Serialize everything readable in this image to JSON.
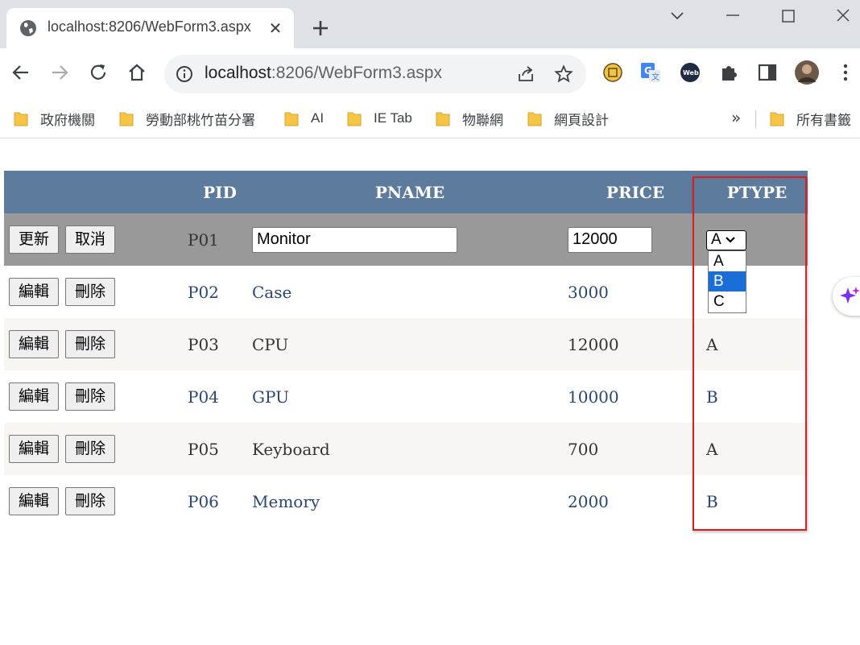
{
  "browser": {
    "tab_title": "localhost:8206/WebForm3.aspx",
    "tab_close": "✕",
    "url_host": "localhost",
    "url_rest": ":8206/WebForm3.aspx"
  },
  "bookmarks": {
    "items": [
      "政府機關",
      "勞動部桃竹苗分署",
      "AI",
      "IE Tab",
      "物聯網",
      "網頁設計"
    ],
    "more": "»",
    "all": "所有書籤"
  },
  "grid": {
    "headers": [
      "",
      "PID",
      "PNAME",
      "PRICE",
      "PTYPE"
    ],
    "edit_row": {
      "update_label": "更新",
      "cancel_label": "取消",
      "pid": "P01",
      "pname": "Monitor",
      "price": "12000",
      "ptype": "A"
    },
    "rows": [
      {
        "edit": "編輯",
        "delete": "刪除",
        "pid": "P02",
        "pname": "Case",
        "price": "3000",
        "ptype": ""
      },
      {
        "edit": "編輯",
        "delete": "刪除",
        "pid": "P03",
        "pname": "CPU",
        "price": "12000",
        "ptype": "A"
      },
      {
        "edit": "編輯",
        "delete": "刪除",
        "pid": "P04",
        "pname": "GPU",
        "price": "10000",
        "ptype": "B"
      },
      {
        "edit": "編輯",
        "delete": "刪除",
        "pid": "P05",
        "pname": "Keyboard",
        "price": "700",
        "ptype": "A"
      },
      {
        "edit": "編輯",
        "delete": "刪除",
        "pid": "P06",
        "pname": "Memory",
        "price": "2000",
        "ptype": "B"
      }
    ],
    "ptype_options": [
      "A",
      "B",
      "C"
    ],
    "ptype_highlighted_option": "B"
  },
  "colors": {
    "header_bg": "#5d7b9d",
    "edit_row_bg": "#999999",
    "alt_row_bg": "#f7f6f3",
    "odd_row_text": "#284775",
    "highlight_border": "#e01b1b",
    "option_selected_bg": "#1a6ed8"
  }
}
